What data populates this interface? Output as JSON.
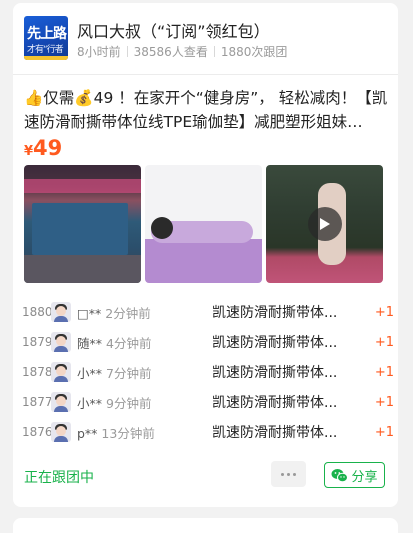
{
  "group": {
    "logo_text_line1": "先上路",
    "logo_text_line2": "才有“行者",
    "author": "风口大叔（“订阅”领红包）",
    "time": "8小时前",
    "views": "38586人查看",
    "joined": "1880次跟团"
  },
  "post": {
    "title_line1": "👍仅需💰49 ！在家开个“健身房”， 轻松减肉！【凯",
    "title_line2": "速防滑耐撕带体位线TPE瑜伽垫】减肥塑形姐妹…",
    "price_symbol": "¥",
    "price": "49"
  },
  "images": [
    {
      "icon": "yoga-mat-photo"
    },
    {
      "icon": "yoga-pose-photo"
    },
    {
      "icon": "yoga-video-thumbnail",
      "play_icon": "play-icon"
    }
  ],
  "orders": [
    {
      "rank": "1880",
      "user": "□**",
      "time": "2分钟前",
      "product": "凯速防滑耐撕带体...",
      "count": "+1"
    },
    {
      "rank": "1879",
      "user": "随**",
      "time": "4分钟前",
      "product": "凯速防滑耐撕带体...",
      "count": "+1"
    },
    {
      "rank": "1878",
      "user": "小**",
      "time": "7分钟前",
      "product": "凯速防滑耐撕带体...",
      "count": "+1"
    },
    {
      "rank": "1877",
      "user": "小**",
      "time": "9分钟前",
      "product": "凯速防滑耐撕带体...",
      "count": "+1"
    },
    {
      "rank": "1876",
      "user": "p**",
      "time": "13分钟前",
      "product": "凯速防滑耐撕带体...",
      "count": "+1"
    }
  ],
  "footer": {
    "status": "正在跟团中",
    "share_label": "分享"
  },
  "colors": {
    "accent_green": "#19b24b",
    "price_orange": "#ff5a1f"
  }
}
